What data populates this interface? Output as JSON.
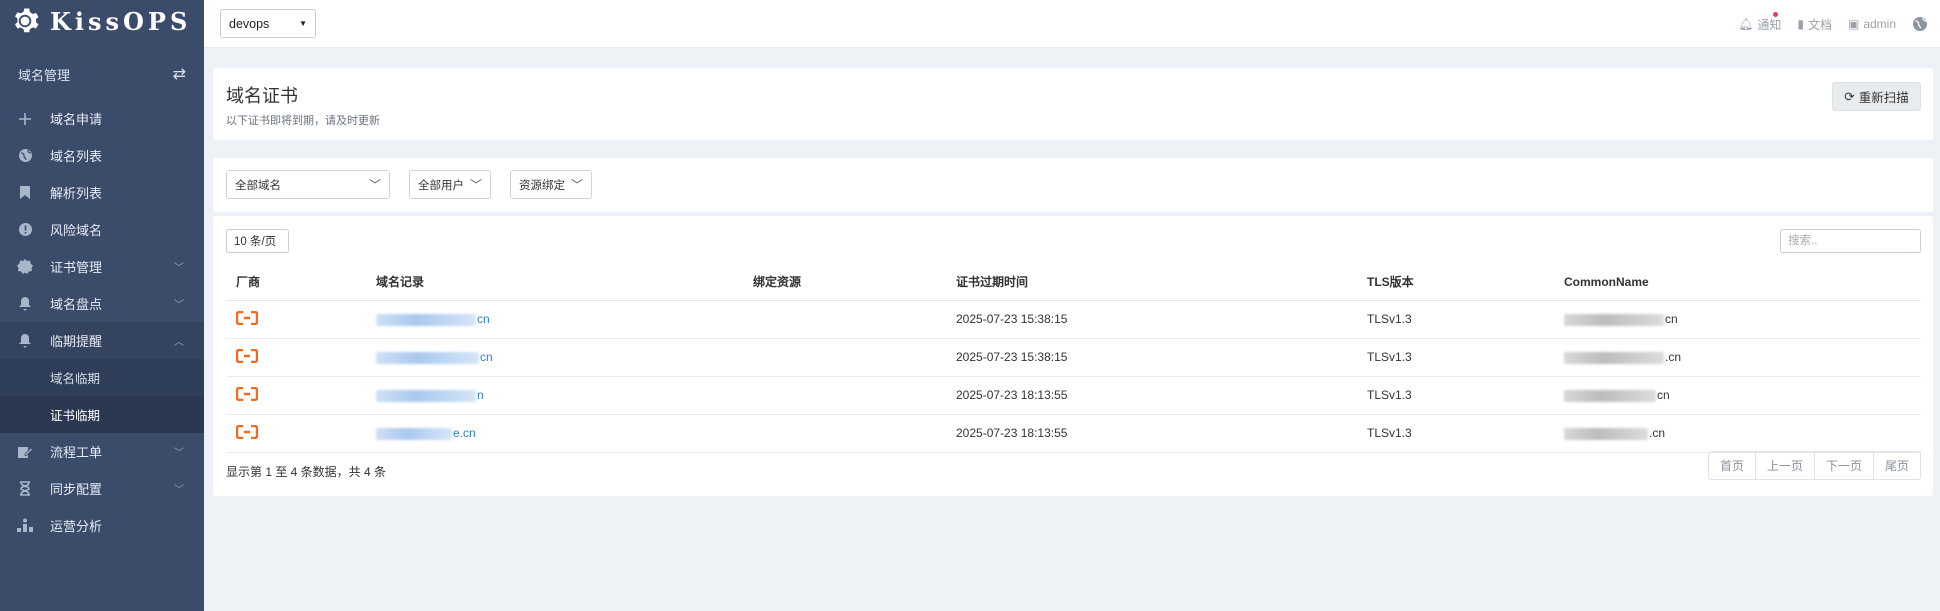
{
  "brand": {
    "name": "KissOPS"
  },
  "sidebar": {
    "section_title": "域名管理",
    "items": [
      {
        "label": "域名申请",
        "icon": "plus-icon"
      },
      {
        "label": "域名列表",
        "icon": "globe-icon"
      },
      {
        "label": "解析列表",
        "icon": "bookmark-icon"
      },
      {
        "label": "风险域名",
        "icon": "alert-icon"
      },
      {
        "label": "证书管理",
        "icon": "certificate-icon"
      },
      {
        "label": "域名盘点",
        "icon": "bell-icon"
      },
      {
        "label": "临期提醒",
        "icon": "bell-icon"
      },
      {
        "label": "流程工单",
        "icon": "edit-icon"
      },
      {
        "label": "同步配置",
        "icon": "hourglass-icon"
      },
      {
        "label": "运营分析",
        "icon": "chart-icon"
      }
    ],
    "subitems": [
      {
        "label": "域名临期"
      },
      {
        "label": "证书临期"
      }
    ]
  },
  "topbar": {
    "env_selected": "devops",
    "notify": "通知",
    "docs": "文档",
    "user": "admin"
  },
  "header": {
    "title": "域名证书",
    "subtitle": "以下证书即将到期，请及时更新",
    "rescan": "重新扫描"
  },
  "filters": {
    "domain": "全部域名",
    "user": "全部用户",
    "resource": "资源绑定"
  },
  "table": {
    "page_size": "10 条/页",
    "search_placeholder": "搜索..",
    "columns": [
      "厂商",
      "域名记录",
      "绑定资源",
      "证书过期时间",
      "TLS版本",
      "CommonName"
    ],
    "rows": [
      {
        "domain_suffix": "cn",
        "resource": "",
        "expire": "2025-07-23 15:38:15",
        "tls": "TLSv1.3",
        "cn_suffix": "cn"
      },
      {
        "domain_suffix": "cn",
        "resource": "",
        "expire": "2025-07-23 15:38:15",
        "tls": "TLSv1.3",
        "cn_suffix": ".cn"
      },
      {
        "domain_suffix": "n",
        "resource": "",
        "expire": "2025-07-23 18:13:55",
        "tls": "TLSv1.3",
        "cn_suffix": "cn"
      },
      {
        "domain_suffix": "e.cn",
        "resource": "",
        "expire": "2025-07-23 18:13:55",
        "tls": "TLSv1.3",
        "cn_suffix": ".cn"
      }
    ],
    "info": "显示第 1 至 4 条数据，共 4 条",
    "pager": {
      "first": "首页",
      "prev": "上一页",
      "next": "下一页",
      "last": "尾页"
    }
  },
  "colors": {
    "sidebar": "#3b4c6a",
    "link": "#2f7fd6",
    "vendor": "#f26b1d"
  }
}
